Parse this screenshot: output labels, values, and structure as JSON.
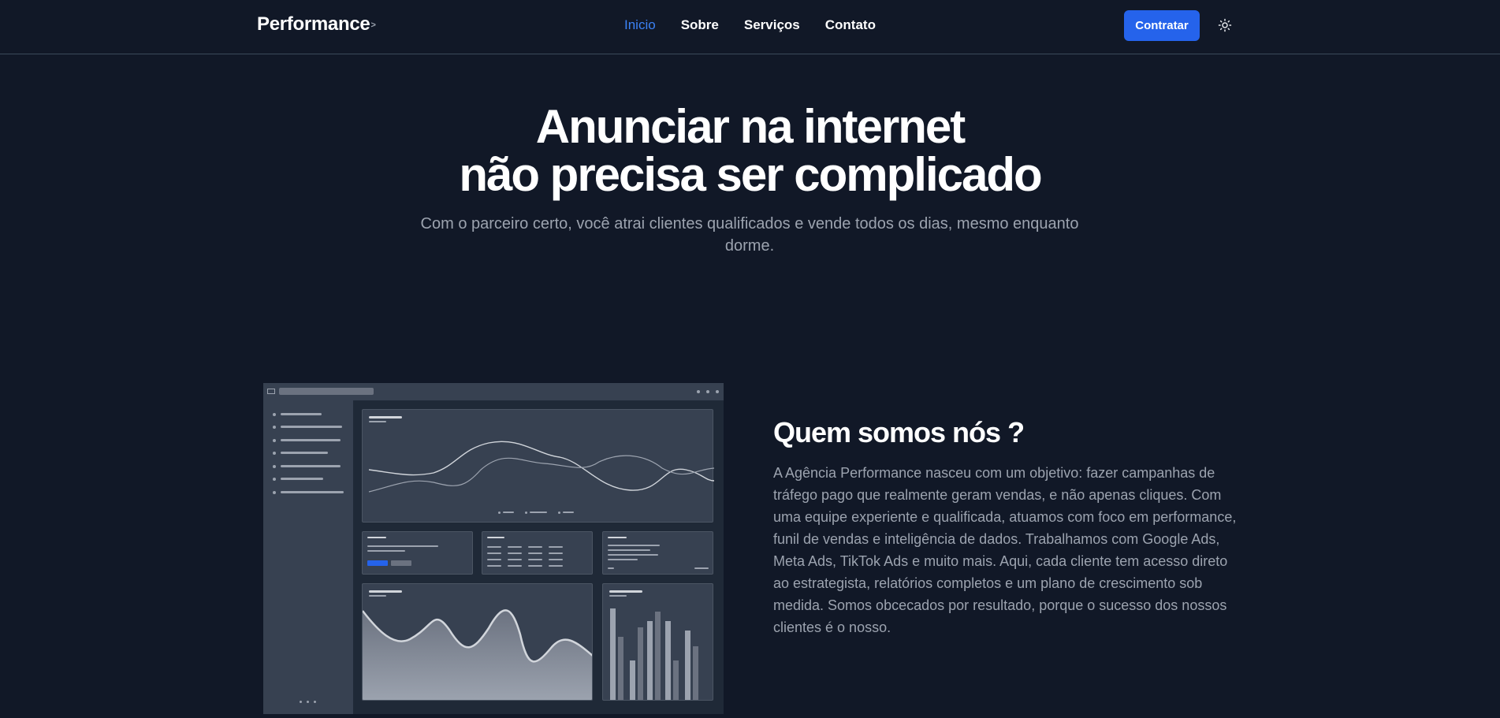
{
  "nav": {
    "brand": "Performance",
    "brand_mark": ">",
    "links": [
      {
        "label": "Inicio",
        "active": true
      },
      {
        "label": "Sobre",
        "active": false
      },
      {
        "label": "Serviços",
        "active": false
      },
      {
        "label": "Contato",
        "active": false
      }
    ],
    "cta_label": "Contratar",
    "theme_icon": "sun-icon"
  },
  "hero": {
    "title_line1": "Anunciar na internet",
    "title_line2": "não precisa ser complicado",
    "subtitle": "Com o parceiro certo, você atrai clientes qualificados e vende todos os dias, mesmo enquanto dorme."
  },
  "about": {
    "title": "Quem somos nós ?",
    "text": "A Agência Performance nasceu com um objetivo: fazer campanhas de tráfego pago que realmente geram vendas, e não apenas cliques. Com uma equipe experiente e qualificada, atuamos com foco em performance, funil de vendas e inteligência de dados. Trabalhamos com Google Ads, Meta Ads, TikTok Ads e muito mais. Aqui, cada cliente tem acesso direto ao estrategista, relatórios completos e um plano de crescimento sob medida. Somos obcecados por resultado, porque o sucesso dos nossos clientes é o nosso."
  },
  "colors": {
    "background": "#111827",
    "accent": "#2563eb",
    "active_link": "#3b82f6",
    "muted_text": "#9ca3af"
  }
}
